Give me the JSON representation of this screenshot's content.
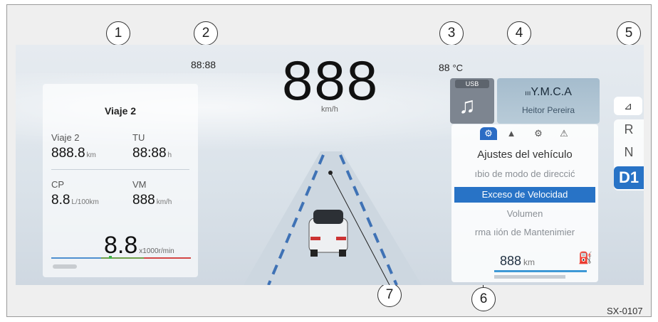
{
  "callouts": [
    "1",
    "2",
    "3",
    "4",
    "5",
    "6",
    "7"
  ],
  "trip": {
    "title": "Viaje 2",
    "trip_label": "Viaje 2",
    "trip_value": "888.8",
    "trip_unit": "km",
    "tu_label": "TU",
    "tu_value": "88:88",
    "tu_unit": "h",
    "cp_label": "CP",
    "cp_value": "8.8",
    "cp_unit": "L/100km",
    "vm_label": "VM",
    "vm_value": "888",
    "vm_unit": "km/h"
  },
  "rpm": {
    "value": "8.8",
    "unit": "x1000r/min",
    "level": 0.42
  },
  "clock": "88:88",
  "speed": {
    "value": "888",
    "unit": "km/h"
  },
  "temperature": {
    "value": "88",
    "unit": "°C"
  },
  "media": {
    "source": "USB",
    "icon": "music-note-icon",
    "song": "Y.M.C.A",
    "artist": "Heitor Pereira"
  },
  "menu": {
    "tabs": [
      "settings-icon",
      "navigation-icon",
      "assist-icon",
      "warning-icon"
    ],
    "title": "Ajustes del vehículo",
    "items": [
      "ıbio de modo de direccić",
      "Exceso de Velocidad",
      "Volumen",
      "rma ıión de Mantenimier"
    ],
    "selected_index": 1,
    "range_value": "888",
    "range_unit": "km",
    "fuel_icon": "fuel-pump-icon"
  },
  "gears": [
    "R",
    "N",
    "D1"
  ],
  "active_gear": "D1",
  "drive_mode_icon": "drive-mode-icon",
  "figure_code": "SX-0107",
  "colors": {
    "accent": "#2873c6",
    "screen_bg": "#dbe3ea"
  }
}
